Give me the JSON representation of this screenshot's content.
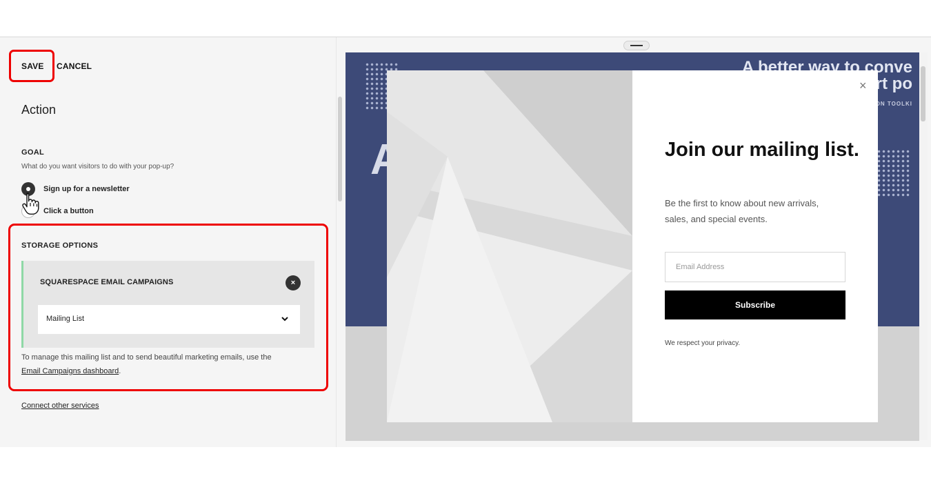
{
  "toolbar": {
    "save_label": "SAVE",
    "cancel_label": "CANCEL"
  },
  "panel": {
    "title": "Action",
    "goal": {
      "label": "GOAL",
      "description": "What do you want visitors to do with your pop-up?",
      "options": [
        {
          "label": "Sign up for a newsletter",
          "selected": true
        },
        {
          "label": "Click a button",
          "selected": false
        }
      ]
    },
    "storage": {
      "label": "STORAGE OPTIONS",
      "service_name": "SQUARESPACE EMAIL CAMPAIGNS",
      "remove_icon": "×",
      "list_select_value": "Mailing List",
      "manage_text": "To manage this mailing list and to send beautiful marketing emails, use the",
      "dashboard_link": "Email Campaigns dashboard",
      "period": "."
    },
    "connect_link": "Connect other services"
  },
  "preview": {
    "bg_headline_line1": "A better way to conve",
    "bg_headline_line2": "rt po",
    "bg_toolkit": "ON TOOLKI",
    "bg_big_letter": "A",
    "popup": {
      "close_icon": "×",
      "title": "Join our mailing list.",
      "description": "Be the first to know about new arrivals, sales, and special events.",
      "email_placeholder": "Email Address",
      "subscribe_label": "Subscribe",
      "privacy_text": "We respect your privacy."
    }
  },
  "colors": {
    "highlight": "#ee0000",
    "accent_green": "#8fd8a6",
    "preview_bg": "#3d4a78",
    "button_bg": "#000000"
  },
  "icons": [
    "drag-handle-icon",
    "hand-cursor-icon",
    "remove-icon",
    "chevron-down-icon",
    "close-icon"
  ]
}
